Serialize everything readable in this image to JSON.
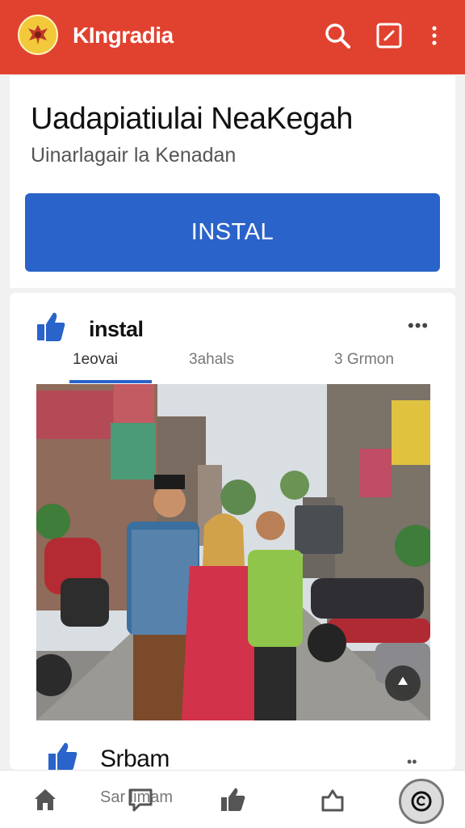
{
  "header": {
    "app_title": "KIngradia",
    "icons": [
      "emblem-logo-icon",
      "search-icon",
      "edit-icon",
      "more-vertical-icon"
    ]
  },
  "promo": {
    "headline": "Uadapiatiulai NeaKegah",
    "subheadline": "Uinarlagair la Kenadan",
    "install_label": "INSTAL"
  },
  "post": {
    "title": "instal",
    "more": "•••",
    "tabs": [
      "1eovai",
      "3ahals",
      "3 Grmon"
    ],
    "photo": "street-photo"
  },
  "post2": {
    "title": "Srbam",
    "more": "••"
  },
  "bottom_nav": {
    "label": "Sar  limam",
    "items": [
      "home-icon",
      "comment-icon",
      "like-icon",
      "share-icon",
      "profile-icon"
    ]
  },
  "colors": {
    "header": "#e14230",
    "accent": "#2a63c9"
  }
}
